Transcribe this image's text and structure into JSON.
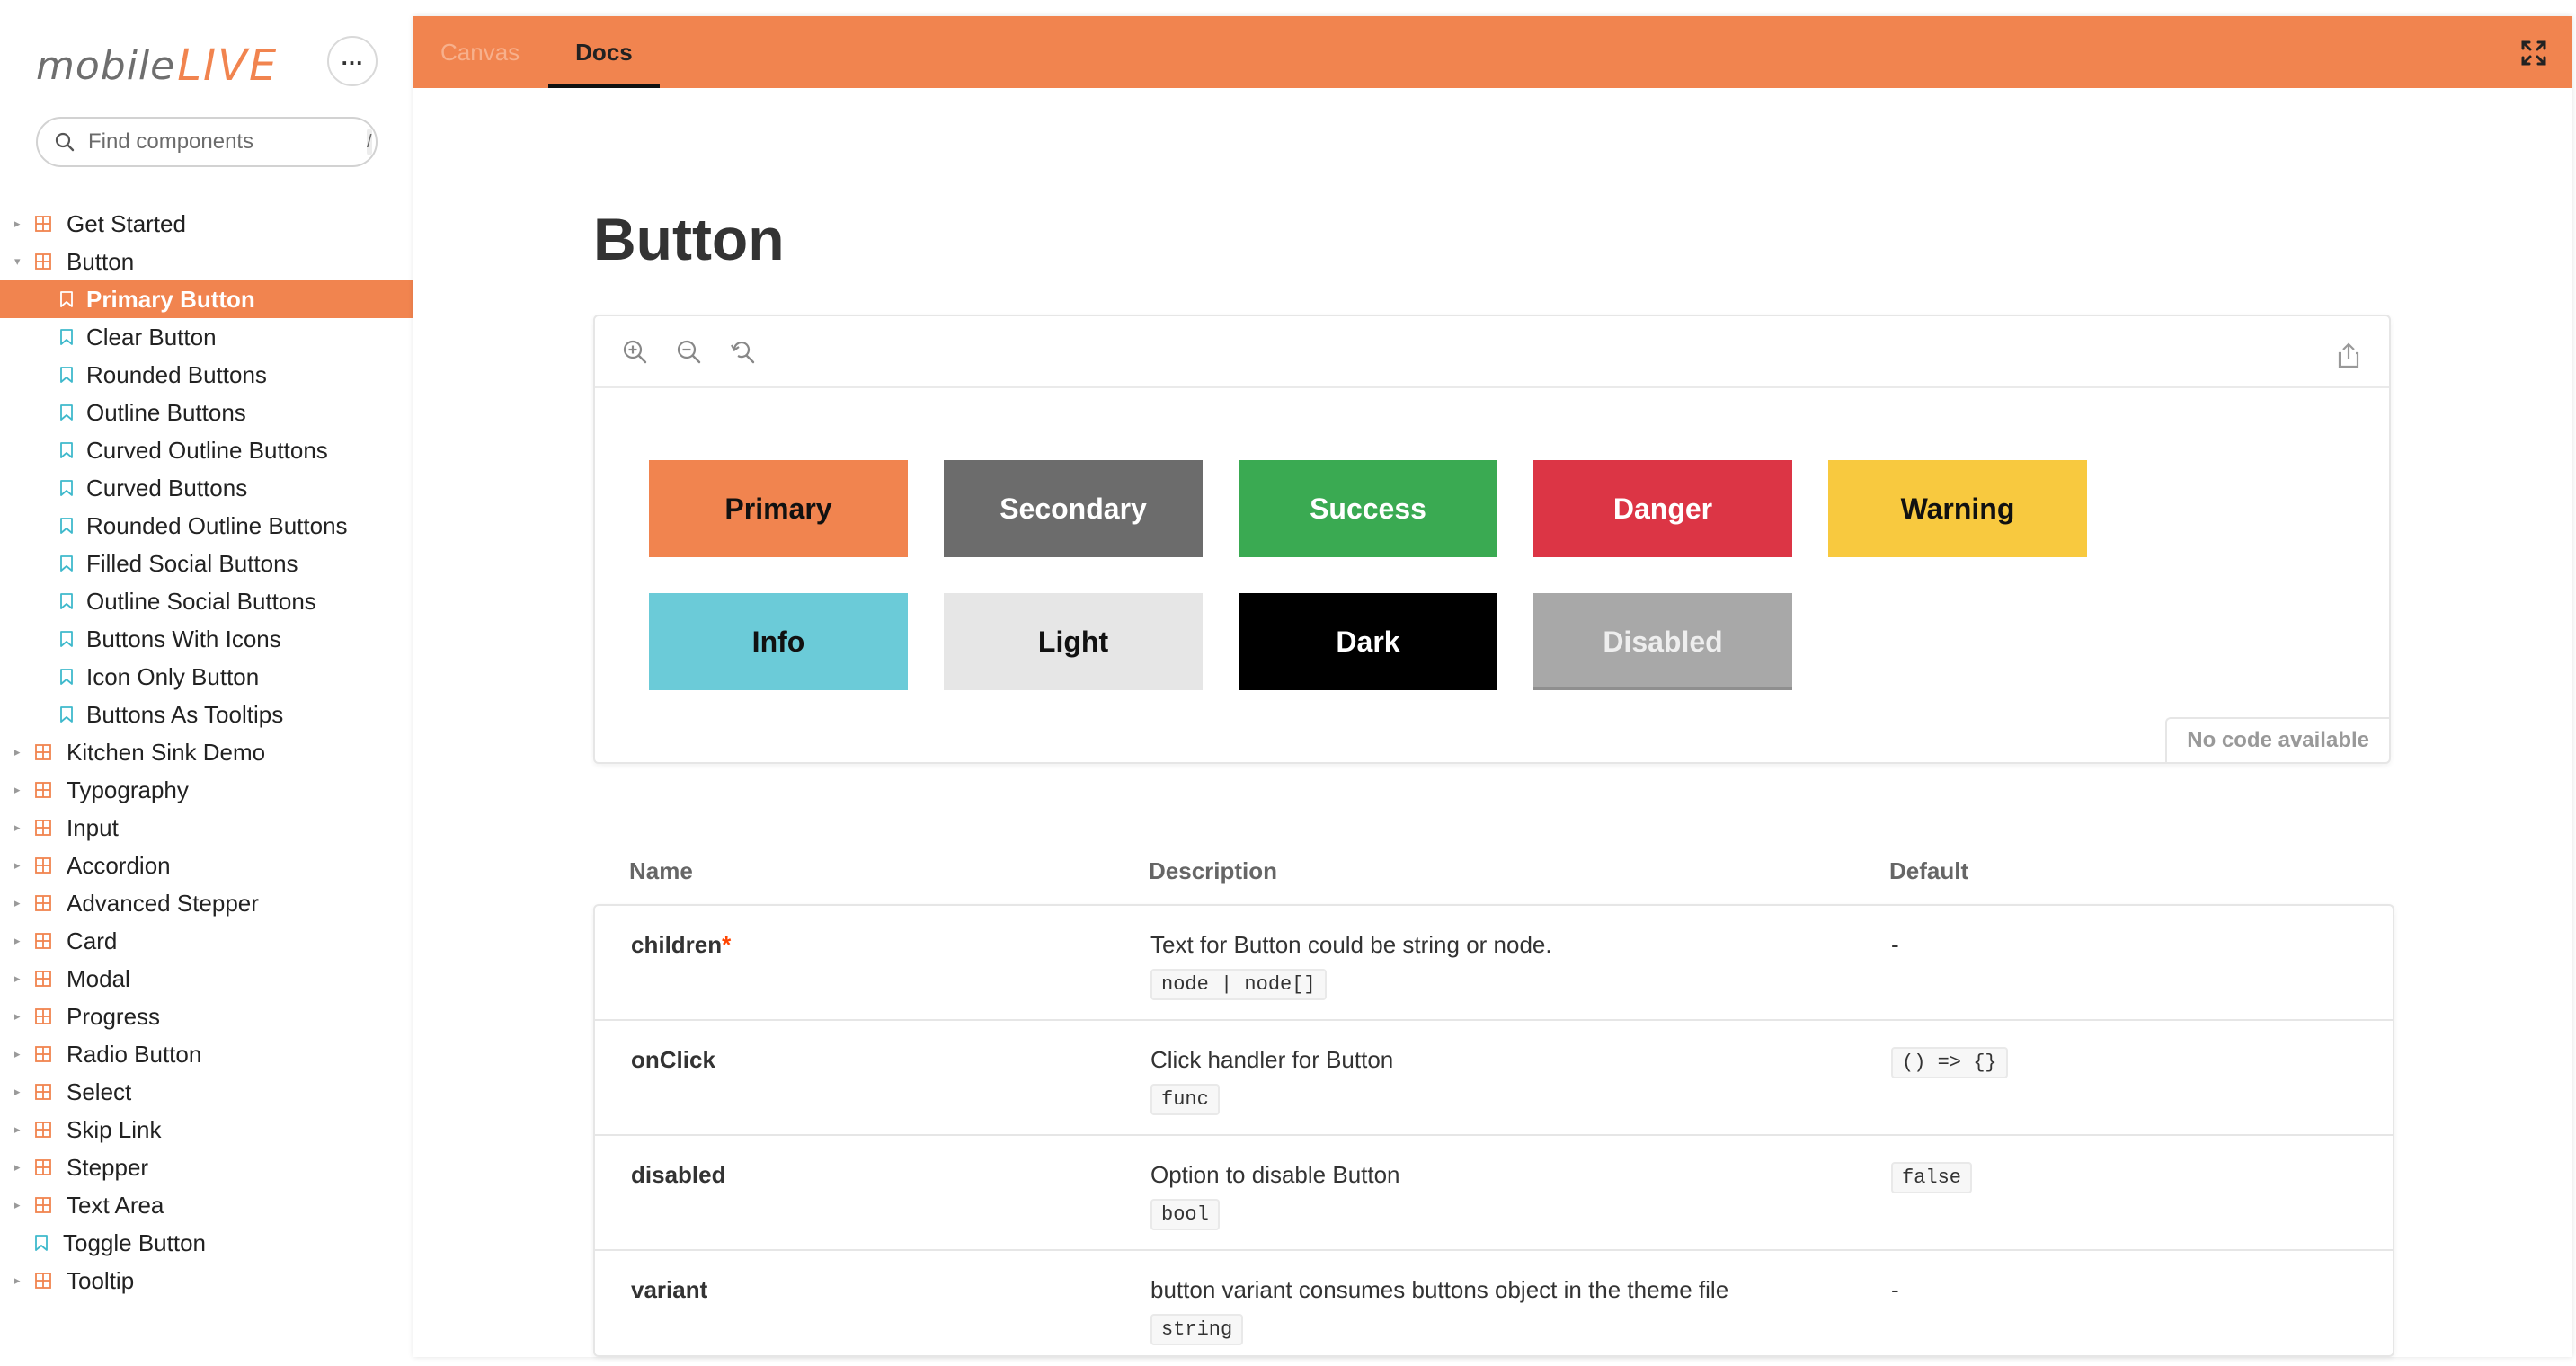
{
  "brand": {
    "logo_part1": "mobile",
    "logo_part2": "LIVE",
    "accent": "#f1844f"
  },
  "sidebar": {
    "menu_icon": "ellipsis-icon",
    "search": {
      "placeholder": "Find components",
      "shortcut": "/"
    },
    "tree": [
      {
        "label": "Get Started",
        "type": "component",
        "expanded": false
      },
      {
        "label": "Button",
        "type": "component",
        "expanded": true
      },
      {
        "label": "Primary Button",
        "type": "story",
        "active": true
      },
      {
        "label": "Clear Button",
        "type": "story"
      },
      {
        "label": "Rounded Buttons",
        "type": "story"
      },
      {
        "label": "Outline Buttons",
        "type": "story"
      },
      {
        "label": "Curved Outline Buttons",
        "type": "story"
      },
      {
        "label": "Curved Buttons",
        "type": "story"
      },
      {
        "label": "Rounded Outline Buttons",
        "type": "story"
      },
      {
        "label": "Filled Social Buttons",
        "type": "story"
      },
      {
        "label": "Outline Social Buttons",
        "type": "story"
      },
      {
        "label": "Buttons With Icons",
        "type": "story"
      },
      {
        "label": "Icon Only Button",
        "type": "story"
      },
      {
        "label": "Buttons As Tooltips",
        "type": "story"
      },
      {
        "label": "Kitchen Sink Demo",
        "type": "component",
        "expanded": false
      },
      {
        "label": "Typography",
        "type": "component",
        "expanded": false
      },
      {
        "label": "Input",
        "type": "component",
        "expanded": false
      },
      {
        "label": "Accordion",
        "type": "component",
        "expanded": false
      },
      {
        "label": "Advanced Stepper",
        "type": "component",
        "expanded": false
      },
      {
        "label": "Card",
        "type": "component",
        "expanded": false
      },
      {
        "label": "Modal",
        "type": "component",
        "expanded": false
      },
      {
        "label": "Progress",
        "type": "component",
        "expanded": false
      },
      {
        "label": "Radio Button",
        "type": "component",
        "expanded": false
      },
      {
        "label": "Select",
        "type": "component",
        "expanded": false
      },
      {
        "label": "Skip Link",
        "type": "component",
        "expanded": false
      },
      {
        "label": "Stepper",
        "type": "component",
        "expanded": false
      },
      {
        "label": "Text Area",
        "type": "component",
        "expanded": false
      },
      {
        "label": "Toggle Button",
        "type": "leaf-story"
      },
      {
        "label": "Tooltip",
        "type": "component",
        "expanded": false
      }
    ]
  },
  "tabs": {
    "canvas": "Canvas",
    "docs": "Docs",
    "active": "Docs"
  },
  "page": {
    "title": "Button"
  },
  "preview": {
    "tools": [
      "zoom-in-icon",
      "zoom-out-icon",
      "reset-zoom-icon"
    ],
    "share_icon": "share-icon",
    "no_code": "No code available",
    "buttons": [
      {
        "label": "Primary",
        "bg": "#f1844f",
        "fg": "#111111"
      },
      {
        "label": "Secondary",
        "bg": "#6c6c6c",
        "fg": "#ffffff"
      },
      {
        "label": "Success",
        "bg": "#3aaa52",
        "fg": "#ffffff"
      },
      {
        "label": "Danger",
        "bg": "#dc3545",
        "fg": "#ffffff"
      },
      {
        "label": "Warning",
        "bg": "#f8c93f",
        "fg": "#111111"
      },
      {
        "label": "Info",
        "bg": "#6bcbd8",
        "fg": "#111111"
      },
      {
        "label": "Light",
        "bg": "#e6e6e6",
        "fg": "#111111"
      },
      {
        "label": "Dark",
        "bg": "#000000",
        "fg": "#ffffff"
      },
      {
        "label": "Disabled",
        "bg": "#a8a8a8",
        "fg": "#eeeeee"
      }
    ]
  },
  "props_table": {
    "headers": {
      "name": "Name",
      "description": "Description",
      "default": "Default"
    },
    "rows": [
      {
        "name": "children",
        "required": "*",
        "description": "Text for Button could be string or node.",
        "type": "node | node[]",
        "default": "-",
        "default_is_code": false
      },
      {
        "name": "onClick",
        "required": "",
        "description": "Click handler for Button",
        "type": "func",
        "default": "() => {}",
        "default_is_code": true
      },
      {
        "name": "disabled",
        "required": "",
        "description": "Option to disable Button",
        "type": "bool",
        "default": "false",
        "default_is_code": true
      },
      {
        "name": "variant",
        "required": "",
        "description": "button variant consumes buttons object in the theme file",
        "type": "string",
        "default": "-",
        "default_is_code": false
      }
    ]
  }
}
